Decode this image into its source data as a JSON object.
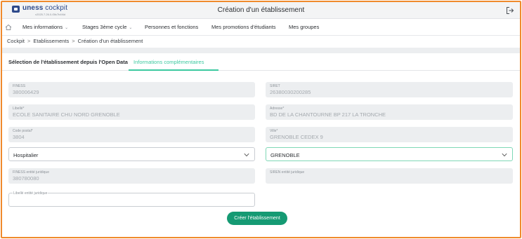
{
  "header": {
    "brand_bold": "uness ",
    "brand_alt": "cockpit",
    "version": "v2025.7.26.0-f3fc7b4f4d",
    "title": "Création d'un établissement"
  },
  "nav": {
    "items": [
      {
        "label": "Mes informations",
        "has_dropdown": true
      },
      {
        "label": "Stages 3ème cycle",
        "has_dropdown": true
      },
      {
        "label": "Personnes et fonctions",
        "has_dropdown": false
      },
      {
        "label": "Mes promotions d'étudiants",
        "has_dropdown": false
      },
      {
        "label": "Mes groupes",
        "has_dropdown": false
      }
    ]
  },
  "breadcrumb": {
    "items": [
      "Cockpit",
      "Etablissements",
      "Création d'un établissement"
    ],
    "separator": ">"
  },
  "tabs": [
    {
      "label": "Sélection de l'établissement depuis l'Open Data",
      "active": false
    },
    {
      "label": "Informations complémentaires",
      "active": true
    }
  ],
  "form": {
    "finess": {
      "label": "FINESS",
      "value": "380006429"
    },
    "siret": {
      "label": "SIRET",
      "value": "26380030200285"
    },
    "libelle": {
      "label": "Libellé*",
      "value": "ECOLE SANITAIRE CHU NORD GRENOBLE"
    },
    "adresse": {
      "label": "Adresse*",
      "value": "BD DE LA CHANTOURNE BP 217 LA TRONCHE"
    },
    "code_postal": {
      "label": "Code postal*",
      "value": "3804"
    },
    "ville": {
      "label": "Ville*",
      "value": "GRENOBLE CEDEX 9"
    },
    "type_select": {
      "value": "Hospitalier"
    },
    "ville_select": {
      "value": "GRENOBLE"
    },
    "finess_juridique": {
      "label": "FINESS entité juridique",
      "value": "380780080"
    },
    "siren_juridique": {
      "label": "SIREN entité juridique",
      "value": ""
    },
    "libelle_juridique": {
      "label": "Libellé entité juridique",
      "value": ""
    }
  },
  "actions": {
    "create_label": "Créer l'établissement"
  },
  "colors": {
    "accent": "#3cc9a0",
    "button": "#159a73",
    "brand": "#2e4a8b",
    "frame": "#f08a2c"
  },
  "icons": {
    "logo": "uness-logo-icon",
    "logout": "logout-icon",
    "home": "home-icon",
    "chevron": "chevron-down-icon"
  }
}
